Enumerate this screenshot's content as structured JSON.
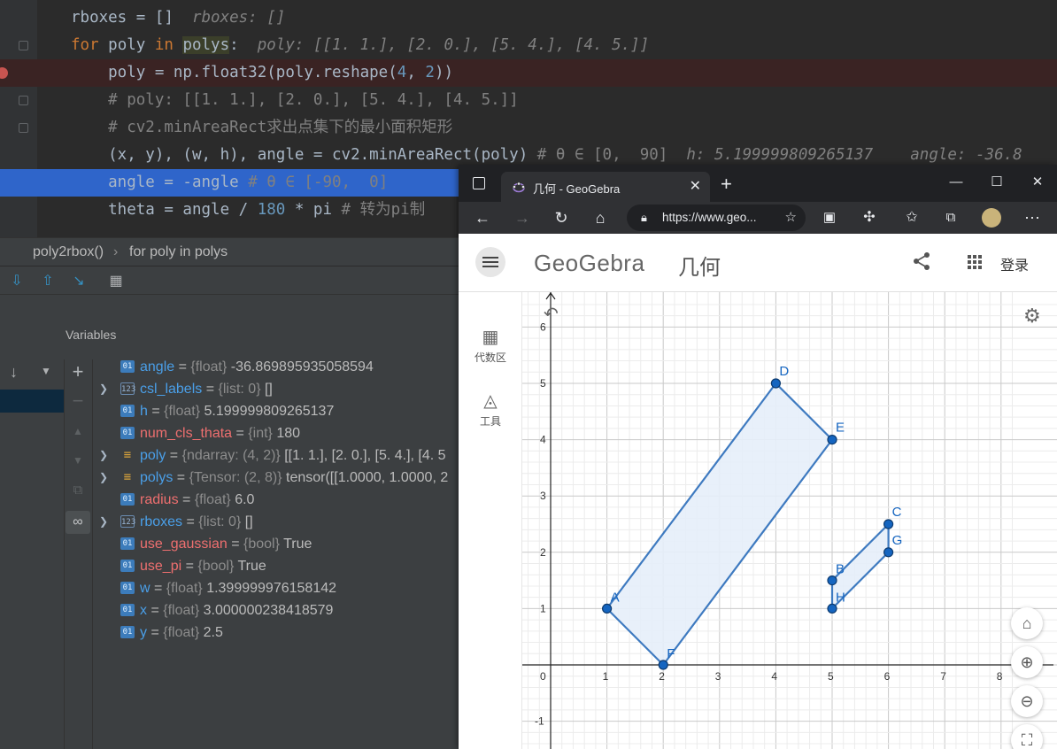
{
  "editor": {
    "lines": [
      {
        "parts": [
          {
            "t": "rboxes = []  ",
            "c": ""
          },
          {
            "t": "rboxes: []",
            "c": "hint"
          }
        ]
      },
      {
        "parts": [
          {
            "t": "for ",
            "c": "kw"
          },
          {
            "t": "poly ",
            "c": ""
          },
          {
            "t": "in ",
            "c": "kw"
          },
          {
            "t": "polys",
            "c": "hl"
          },
          {
            "t": ":  ",
            "c": ""
          },
          {
            "t": "poly: [[1. 1.], [2. 0.], [5. 4.], [4. 5.]]",
            "c": "hint"
          }
        ]
      },
      {
        "parts": [
          {
            "t": "    poly = np.float32(poly.reshape(",
            "c": ""
          },
          {
            "t": "4",
            "c": "num"
          },
          {
            "t": ", ",
            "c": ""
          },
          {
            "t": "2",
            "c": "num"
          },
          {
            "t": "))",
            "c": ""
          }
        ]
      },
      {
        "parts": [
          {
            "t": "    # poly: [[1. 1.], [2. 0.], [5. 4.], [4. 5.]]",
            "c": "cm"
          }
        ]
      },
      {
        "parts": [
          {
            "t": "    # cv2.minAreaRect求出点集下的最小面积矩形",
            "c": "cm"
          }
        ]
      },
      {
        "parts": [
          {
            "t": "    (x, y), (w, h), angle = cv2.minAreaRect(poly) ",
            "c": ""
          },
          {
            "t": "# θ ∈ [0,  90]",
            "c": "cm"
          },
          {
            "t": "  h: 5.199999809265137    angle: -36.8",
            "c": "hint"
          }
        ]
      },
      {
        "parts": [
          {
            "t": "    angle = -angle ",
            "c": ""
          },
          {
            "t": "# θ ∈ [-90,  0]",
            "c": "cm"
          }
        ]
      },
      {
        "parts": [
          {
            "t": "    theta = angle / ",
            "c": ""
          },
          {
            "t": "180",
            "c": "num"
          },
          {
            "t": " * pi ",
            "c": ""
          },
          {
            "t": "# 转为pi制",
            "c": "cm"
          }
        ]
      }
    ]
  },
  "breadcrumb": {
    "fn": "poly2rbox()",
    "loop": "for poly in polys"
  },
  "debug": {
    "variables_title": "Variables",
    "variables": [
      {
        "name": "angle",
        "type": "{float}",
        "value": "-36.869895935058594",
        "icon": "01",
        "kind": "prim",
        "color": "blue",
        "expand": false
      },
      {
        "name": "csl_labels",
        "type": "{list: 0}",
        "value": "[]",
        "icon": "123",
        "kind": "list",
        "color": "blue",
        "expand": true
      },
      {
        "name": "h",
        "type": "{float}",
        "value": "5.199999809265137",
        "icon": "01",
        "kind": "prim",
        "color": "blue",
        "expand": false
      },
      {
        "name": "num_cls_thata",
        "type": "{int}",
        "value": "180",
        "icon": "01",
        "kind": "prim",
        "color": "red",
        "expand": false
      },
      {
        "name": "poly",
        "type": "{ndarray: (4, 2)}",
        "value": "[[1. 1.], [2. 0.], [5. 4.], [4. 5",
        "icon": "≡",
        "kind": "arr",
        "color": "blue",
        "expand": true
      },
      {
        "name": "polys",
        "type": "{Tensor: (2, 8)}",
        "value": "tensor([[1.0000, 1.0000, 2",
        "icon": "≡",
        "kind": "arr",
        "color": "blue",
        "expand": true
      },
      {
        "name": "radius",
        "type": "{float}",
        "value": "6.0",
        "icon": "01",
        "kind": "prim",
        "color": "red",
        "expand": false
      },
      {
        "name": "rboxes",
        "type": "{list: 0}",
        "value": "[]",
        "icon": "123",
        "kind": "list",
        "color": "blue",
        "expand": true
      },
      {
        "name": "use_gaussian",
        "type": "{bool}",
        "value": "True",
        "icon": "01",
        "kind": "prim",
        "color": "red",
        "expand": false
      },
      {
        "name": "use_pi",
        "type": "{bool}",
        "value": "True",
        "icon": "01",
        "kind": "prim",
        "color": "red",
        "expand": false
      },
      {
        "name": "w",
        "type": "{float}",
        "value": "1.399999976158142",
        "icon": "01",
        "kind": "prim",
        "color": "blue",
        "expand": false
      },
      {
        "name": "x",
        "type": "{float}",
        "value": "3.000000238418579",
        "icon": "01",
        "kind": "prim",
        "color": "blue",
        "expand": false
      },
      {
        "name": "y",
        "type": "{float}",
        "value": "2.5",
        "icon": "01",
        "kind": "prim",
        "color": "blue",
        "expand": false
      }
    ]
  },
  "browser": {
    "tab_title": "几何 - GeoGebra",
    "url": "https://www.geo...",
    "geogebra": {
      "logo": "GeoGebra",
      "app_name": "几何",
      "login": "登录",
      "left_items": [
        {
          "label": "代数区",
          "icon": "calculator-icon"
        },
        {
          "label": "工具",
          "icon": "tools-icon"
        }
      ]
    }
  },
  "chart_data": {
    "type": "scatter",
    "xlim": [
      -0.5,
      8.2
    ],
    "ylim": [
      -1.4,
      6.5
    ],
    "grid": true,
    "x_ticks": [
      0,
      1,
      2,
      3,
      4,
      5,
      6,
      7,
      8
    ],
    "y_ticks": [
      -1,
      1,
      2,
      3,
      4,
      5,
      6
    ],
    "points": [
      {
        "name": "A",
        "x": 1,
        "y": 1
      },
      {
        "name": "B",
        "x": 5,
        "y": 1.5
      },
      {
        "name": "C",
        "x": 6,
        "y": 2.5
      },
      {
        "name": "D",
        "x": 4,
        "y": 5
      },
      {
        "name": "E",
        "x": 5,
        "y": 4
      },
      {
        "name": "F",
        "x": 2,
        "y": 0
      },
      {
        "name": "G",
        "x": 6,
        "y": 2
      },
      {
        "name": "H",
        "x": 5,
        "y": 1
      }
    ],
    "polygons": [
      {
        "vertices": [
          "A",
          "F",
          "E",
          "D"
        ]
      },
      {
        "vertices": [
          "H",
          "G",
          "C",
          "B"
        ]
      }
    ],
    "colors": {
      "stroke": "#3e7ac0",
      "fill": "#e6eef9",
      "point": "#1565c0"
    }
  }
}
